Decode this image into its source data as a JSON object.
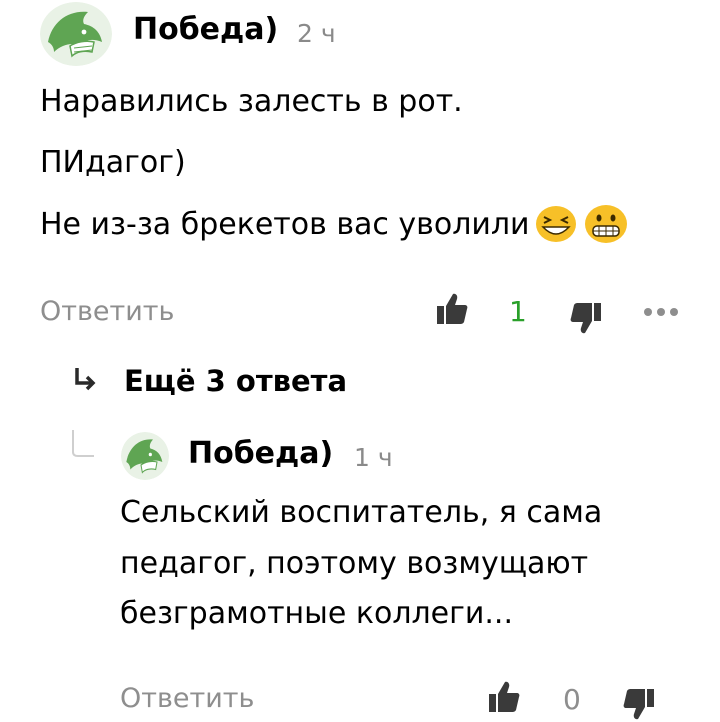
{
  "comment": {
    "author": "Победа)",
    "time": "2 ч",
    "lines": [
      "Наравились залесть в рот.",
      "ПИдагог)",
      "Не из-за брекетов вас уволили"
    ],
    "emojis": [
      "grinning-squinting-face",
      "grimacing-face"
    ],
    "reply_label": "Ответить",
    "like_count": "1"
  },
  "more_replies": {
    "label": "Ещё 3 ответа"
  },
  "reply": {
    "author": "Победа)",
    "time": "1 ч",
    "lines": [
      "Сельский воспитатель, я сама",
      "педагог, поэтому возмущают",
      "безграмотные коллеги..."
    ],
    "reply_label": "Ответить",
    "like_count": "0"
  },
  "colors": {
    "avatar_green": "#5fa553",
    "like_active": "#2aa02a",
    "muted": "#8e8e8e",
    "icon_dark": "#3a3a3a",
    "emoji_yellow": "#f7c028"
  }
}
